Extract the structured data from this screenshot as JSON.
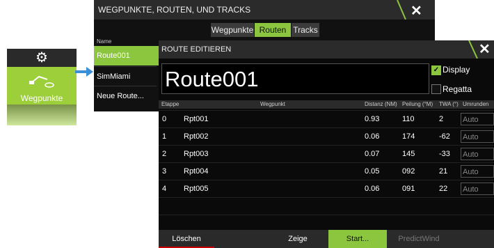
{
  "home_tile": {
    "label": "Wegpunkte"
  },
  "background_window": {
    "title": "WEGPUNKTE, ROUTEN, UND TRACKS",
    "tabs": [
      "Wegpunkte",
      "Routen",
      "Tracks"
    ],
    "list_header": "Name",
    "items": [
      "Route001",
      "SimMiami",
      "Neue Route..."
    ]
  },
  "dialog": {
    "title": "ROUTE EDITIEREN",
    "route_name": "Route001",
    "display_label": "Display",
    "display_checked": true,
    "regatta_label": "Regatta",
    "regatta_checked": false,
    "columns": {
      "etappe": "Etappe",
      "wegpunkt": "Wegpunkt",
      "distanz": "Distanz (NM)",
      "peilung": "Peilung (°M)",
      "twa": "TWA (°)",
      "umrunden": "Umrunden"
    },
    "rows": [
      {
        "etappe": "0",
        "wegpunkt": "Rpt001",
        "distanz": "0.93",
        "peilung": "110",
        "twa": "2",
        "umrunden": "Auto"
      },
      {
        "etappe": "1",
        "wegpunkt": "Rpt002",
        "distanz": "0.06",
        "peilung": "174",
        "twa": "-62",
        "umrunden": "Auto"
      },
      {
        "etappe": "2",
        "wegpunkt": "Rpt003",
        "distanz": "0.07",
        "peilung": "145",
        "twa": "-33",
        "umrunden": "Auto"
      },
      {
        "etappe": "3",
        "wegpunkt": "Rpt004",
        "distanz": "0.05",
        "peilung": "092",
        "twa": "21",
        "umrunden": "Auto"
      },
      {
        "etappe": "4",
        "wegpunkt": "Rpt005",
        "distanz": "0.06",
        "peilung": "091",
        "twa": "22",
        "umrunden": "Auto"
      }
    ],
    "buttons": {
      "delete": "Löschen",
      "show": "Zeige",
      "start": "Start...",
      "predictwind": "PredictWind"
    }
  },
  "colors": {
    "accent": "#8cc63f",
    "arrow": "#3a8fd6"
  }
}
